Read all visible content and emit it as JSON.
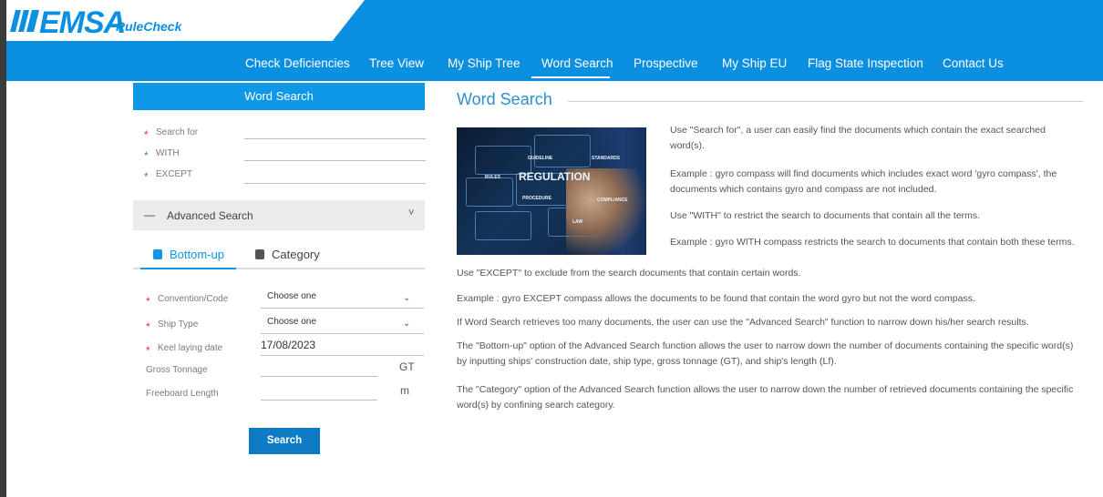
{
  "header": {
    "logo_text": "EMSA",
    "logo_sub": "RuleCheck",
    "brand_color": "#0b8fe0",
    "nav": [
      "Check Deficiencies",
      "Tree View",
      "My Ship Tree",
      "Word Search",
      "Prospective",
      "My Ship EU",
      "Flag State Inspection",
      "Contact Us"
    ],
    "active_nav": "Word Search"
  },
  "sidebar": {
    "title": "Word Search",
    "search_fields": [
      {
        "label": "Search for",
        "value": "",
        "required": true
      },
      {
        "label": "WITH",
        "value": "",
        "required": false
      },
      {
        "label": "EXCEPT",
        "value": "",
        "required": false
      }
    ],
    "advanced": {
      "toggle": "—",
      "label": "Advanced Search",
      "chevron": "˅"
    },
    "tabs": [
      {
        "label": "Bottom-up",
        "icon": "document-icon",
        "active": true
      },
      {
        "label": "Category",
        "icon": "document-icon",
        "active": false
      }
    ],
    "filters": {
      "convention_code": {
        "label": "Convention/Code",
        "value": "Choose one"
      },
      "ship_type": {
        "label": "Ship Type",
        "value": "Choose one"
      },
      "keel_date": {
        "label": "Keel laying date",
        "value": "17/08/2023"
      },
      "gross_tonnage": {
        "label": "Gross Tonnage",
        "value": "",
        "unit": "GT"
      },
      "freeboard_length": {
        "label": "Freeboard Length",
        "value": "",
        "unit": "m"
      }
    },
    "search_button": "Search"
  },
  "main": {
    "title": "Word Search",
    "image_labels": {
      "main": "REGULATION",
      "guideline": "GUIDELINE",
      "standards": "STANDARDS",
      "rules": "RULES",
      "procedure": "PROCEDURE",
      "compliance": "COMPLIANCE",
      "law": "LAW"
    },
    "paragraphs": [
      "Use \"Search for\", a user can easily find the documents which contain the exact searched word(s).",
      "Example : gyro compass will find documents which includes exact word 'gyro compass', the documents which contains gyro and compass are not included.",
      "Use \"WITH\" to restrict the search to documents that contain all the terms.",
      "Example : gyro WITH compass restricts the search to documents that contain both these terms.",
      "Use \"EXCEPT\" to exclude from the search documents that contain certain words.",
      "Example : gyro EXCEPT compass allows the documents to be found that contain the word gyro but not the word compass.",
      "If Word Search retrieves too many documents, the user can use the \"Advanced Search\" function to narrow down his/her search results.",
      "The \"Bottom-up\" option of the Advanced Search function allows the user to narrow down the number of documents containing the specific word(s) by inputting ships' construction date, ship type, gross tonnage (GT), and ship's length (Lf).",
      "The \"Category\" option of the Advanced Search function allows the user to narrow down the number of retrieved documents containing the specific word(s) by confining search category."
    ]
  }
}
